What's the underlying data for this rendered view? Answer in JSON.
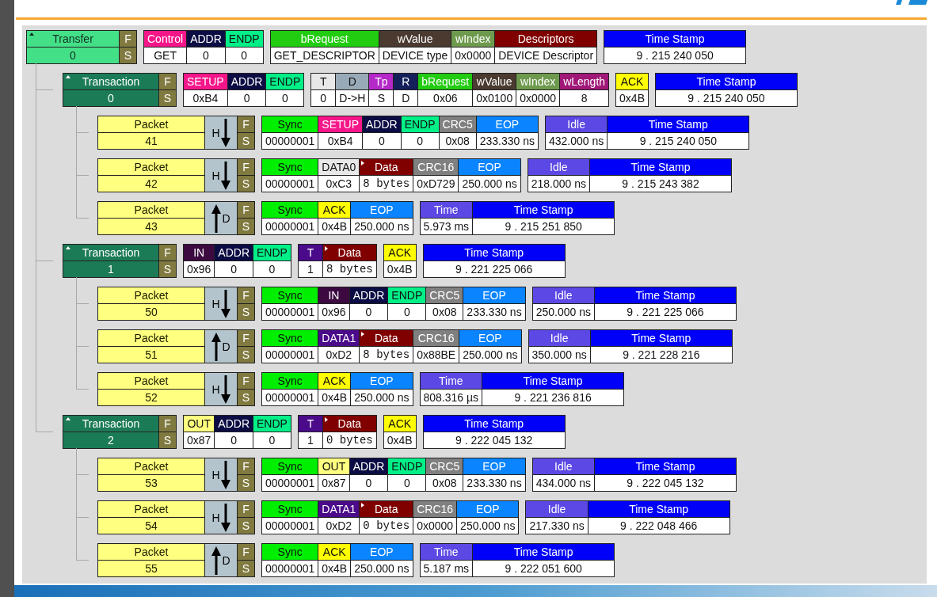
{
  "rows": [
    {
      "kind": "transfer",
      "label": "Transfer",
      "number": "0",
      "expanded": true,
      "f": "F",
      "s": "S",
      "groups": [
        [
          {
            "kind": "field",
            "label": "Control",
            "value": "GET",
            "color": "#f5168a"
          },
          {
            "kind": "field",
            "label": "ADDR",
            "value": "0",
            "color": "#0c0c44"
          },
          {
            "kind": "field",
            "label": "ENDP",
            "value": "0",
            "color": "#00f088"
          }
        ],
        [
          {
            "kind": "field",
            "label": "bRequest",
            "value": "GET_DESCRIPTOR",
            "color": "#22cc11"
          },
          {
            "kind": "field",
            "label": "wValue",
            "value": "DEVICE type",
            "color": "#4a3a30"
          },
          {
            "kind": "field",
            "label": "wIndex",
            "value": "0x0000",
            "color": "#6e9a4e"
          },
          {
            "kind": "field",
            "label": "Descriptors",
            "value": "DEVICE Descriptor",
            "color": "#800000"
          }
        ],
        [
          {
            "kind": "field",
            "label": "Time Stamp",
            "value": "9 . 215 240 050",
            "color": "#0000f8"
          }
        ]
      ],
      "children": [
        {
          "kind": "transaction",
          "label": "Transaction",
          "number": "0",
          "expanded": true,
          "f": "F",
          "s": "S",
          "groups": [
            [
              {
                "kind": "field",
                "label": "SETUP",
                "value": "0xB4",
                "color": "#f5168a"
              },
              {
                "kind": "field",
                "label": "ADDR",
                "value": "0",
                "color": "#0c0c44"
              },
              {
                "kind": "field",
                "label": "ENDP",
                "value": "0",
                "color": "#00f088"
              }
            ],
            [
              {
                "kind": "field",
                "label": "T",
                "value": "0",
                "color": "#e8e8e8"
              },
              {
                "kind": "field",
                "label": "D",
                "value": "D->H",
                "color": "#98aab8"
              },
              {
                "kind": "field",
                "label": "Tp",
                "value": "S",
                "color": "#b428c8"
              },
              {
                "kind": "field",
                "label": "R",
                "value": "D",
                "color": "#14205a"
              },
              {
                "kind": "field",
                "label": "bRequest",
                "value": "0x06",
                "color": "#22cc11"
              },
              {
                "kind": "field",
                "label": "wValue",
                "value": "0x0100",
                "color": "#4a3a30"
              },
              {
                "kind": "field",
                "label": "wIndex",
                "value": "0x0000",
                "color": "#6e9a4e"
              },
              {
                "kind": "field",
                "label": "wLength",
                "value": "8",
                "color": "#a01878"
              }
            ],
            [
              {
                "kind": "field",
                "label": "ACK",
                "value": "0x4B",
                "color": "#ffff00"
              }
            ],
            [
              {
                "kind": "field",
                "label": "Time Stamp",
                "value": "9 . 215 240 050",
                "color": "#0000f8"
              }
            ]
          ],
          "children": [
            {
              "kind": "packet",
              "label": "Packet",
              "number": "41",
              "upward": false,
              "side": "H",
              "f": "F",
              "s": "S",
              "groups": [
                [
                  {
                    "kind": "field",
                    "label": "Sync",
                    "value": "00000001",
                    "color": "#00ee00"
                  },
                  {
                    "kind": "field",
                    "label": "SETUP",
                    "value": "0xB4",
                    "color": "#f5168a"
                  },
                  {
                    "kind": "field",
                    "label": "ADDR",
                    "value": "0",
                    "color": "#0c0c44"
                  },
                  {
                    "kind": "field",
                    "label": "ENDP",
                    "value": "0",
                    "color": "#00f088"
                  },
                  {
                    "kind": "field",
                    "label": "CRC5",
                    "value": "0x08",
                    "color": "#808080"
                  },
                  {
                    "kind": "field",
                    "label": "EOP",
                    "value": "233.330 ns",
                    "color": "#0a84ff"
                  }
                ],
                [
                  {
                    "kind": "field",
                    "label": "Idle",
                    "value": "432.000 ns",
                    "color": "#5c48e4"
                  },
                  {
                    "kind": "field",
                    "label": "Time Stamp",
                    "value": "9 . 215 240 050",
                    "color": "#0000f8"
                  }
                ]
              ]
            },
            {
              "kind": "packet",
              "label": "Packet",
              "number": "42",
              "upward": false,
              "side": "H",
              "f": "F",
              "s": "S",
              "groups": [
                [
                  {
                    "kind": "field",
                    "label": "Sync",
                    "value": "00000001",
                    "color": "#00ee00"
                  },
                  {
                    "kind": "field",
                    "label": "DATA0",
                    "value": "0xC3",
                    "color": "#e8e8e8"
                  },
                  {
                    "kind": "data",
                    "label": "Data",
                    "value": "8 bytes",
                    "color": "#800000"
                  },
                  {
                    "kind": "field",
                    "label": "CRC16",
                    "value": "0xD729",
                    "color": "#808080"
                  },
                  {
                    "kind": "field",
                    "label": "EOP",
                    "value": "250.000 ns",
                    "color": "#0a84ff"
                  }
                ],
                [
                  {
                    "kind": "field",
                    "label": "Idle",
                    "value": "218.000 ns",
                    "color": "#5c48e4"
                  },
                  {
                    "kind": "field",
                    "label": "Time Stamp",
                    "value": "9 . 215 243 382",
                    "color": "#0000f8"
                  }
                ]
              ]
            },
            {
              "kind": "packet",
              "label": "Packet",
              "number": "43",
              "upward": true,
              "side": "D",
              "f": "F",
              "s": "S",
              "groups": [
                [
                  {
                    "kind": "field",
                    "label": "Sync",
                    "value": "00000001",
                    "color": "#00ee00"
                  },
                  {
                    "kind": "field",
                    "label": "ACK",
                    "value": "0x4B",
                    "color": "#ffff00"
                  },
                  {
                    "kind": "field",
                    "label": "EOP",
                    "value": "250.000 ns",
                    "color": "#0a84ff"
                  }
                ],
                [
                  {
                    "kind": "field",
                    "label": "Time",
                    "value": "5.973 ms",
                    "color": "#5c48e4"
                  },
                  {
                    "kind": "field",
                    "label": "Time Stamp",
                    "value": "9 . 215 251 850",
                    "color": "#0000f8"
                  }
                ]
              ]
            }
          ]
        },
        {
          "kind": "transaction",
          "label": "Transaction",
          "number": "1",
          "expanded": true,
          "f": "F",
          "s": "S",
          "groups": [
            [
              {
                "kind": "field",
                "label": "IN",
                "value": "0x96",
                "color": "#3c0a40"
              },
              {
                "kind": "field",
                "label": "ADDR",
                "value": "0",
                "color": "#0c0c44"
              },
              {
                "kind": "field",
                "label": "ENDP",
                "value": "0",
                "color": "#00f088"
              }
            ],
            [
              {
                "kind": "field",
                "label": "T",
                "value": "1",
                "color": "#4a0a8a"
              },
              {
                "kind": "data",
                "label": "Data",
                "value": "8 bytes",
                "color": "#800000"
              }
            ],
            [
              {
                "kind": "field",
                "label": "ACK",
                "value": "0x4B",
                "color": "#ffff00"
              }
            ],
            [
              {
                "kind": "field",
                "label": "Time Stamp",
                "value": "9 . 221 225 066",
                "color": "#0000f8"
              }
            ]
          ],
          "children": [
            {
              "kind": "packet",
              "label": "Packet",
              "number": "50",
              "upward": false,
              "side": "H",
              "f": "F",
              "s": "S",
              "groups": [
                [
                  {
                    "kind": "field",
                    "label": "Sync",
                    "value": "00000001",
                    "color": "#00ee00"
                  },
                  {
                    "kind": "field",
                    "label": "IN",
                    "value": "0x96",
                    "color": "#3c0a40"
                  },
                  {
                    "kind": "field",
                    "label": "ADDR",
                    "value": "0",
                    "color": "#0c0c44"
                  },
                  {
                    "kind": "field",
                    "label": "ENDP",
                    "value": "0",
                    "color": "#00f088"
                  },
                  {
                    "kind": "field",
                    "label": "CRC5",
                    "value": "0x08",
                    "color": "#808080"
                  },
                  {
                    "kind": "field",
                    "label": "EOP",
                    "value": "233.330 ns",
                    "color": "#0a84ff"
                  }
                ],
                [
                  {
                    "kind": "field",
                    "label": "Idle",
                    "value": "250.000 ns",
                    "color": "#5c48e4"
                  },
                  {
                    "kind": "field",
                    "label": "Time Stamp",
                    "value": "9 . 221 225 066",
                    "color": "#0000f8"
                  }
                ]
              ]
            },
            {
              "kind": "packet",
              "label": "Packet",
              "number": "51",
              "upward": true,
              "side": "D",
              "f": "F",
              "s": "S",
              "groups": [
                [
                  {
                    "kind": "field",
                    "label": "Sync",
                    "value": "00000001",
                    "color": "#00ee00"
                  },
                  {
                    "kind": "field",
                    "label": "DATA1",
                    "value": "0xD2",
                    "color": "#4a0a8a"
                  },
                  {
                    "kind": "data",
                    "label": "Data",
                    "value": "8 bytes",
                    "color": "#800000"
                  },
                  {
                    "kind": "field",
                    "label": "CRC16",
                    "value": "0x88BE",
                    "color": "#808080"
                  },
                  {
                    "kind": "field",
                    "label": "EOP",
                    "value": "250.000 ns",
                    "color": "#0a84ff"
                  }
                ],
                [
                  {
                    "kind": "field",
                    "label": "Idle",
                    "value": "350.000 ns",
                    "color": "#5c48e4"
                  },
                  {
                    "kind": "field",
                    "label": "Time Stamp",
                    "value": "9 . 221 228 216",
                    "color": "#0000f8"
                  }
                ]
              ]
            },
            {
              "kind": "packet",
              "label": "Packet",
              "number": "52",
              "upward": false,
              "side": "H",
              "f": "F",
              "s": "S",
              "groups": [
                [
                  {
                    "kind": "field",
                    "label": "Sync",
                    "value": "00000001",
                    "color": "#00ee00"
                  },
                  {
                    "kind": "field",
                    "label": "ACK",
                    "value": "0x4B",
                    "color": "#ffff00"
                  },
                  {
                    "kind": "field",
                    "label": "EOP",
                    "value": "250.000 ns",
                    "color": "#0a84ff"
                  }
                ],
                [
                  {
                    "kind": "field",
                    "label": "Time",
                    "value": "808.316 µs",
                    "color": "#5c48e4"
                  },
                  {
                    "kind": "field",
                    "label": "Time Stamp",
                    "value": "9 . 221 236 816",
                    "color": "#0000f8"
                  }
                ]
              ]
            }
          ]
        },
        {
          "kind": "transaction",
          "label": "Transaction",
          "number": "2",
          "expanded": true,
          "f": "F",
          "s": "S",
          "groups": [
            [
              {
                "kind": "field",
                "label": "OUT",
                "value": "0x87",
                "color": "#ffff80"
              },
              {
                "kind": "field",
                "label": "ADDR",
                "value": "0",
                "color": "#0c0c44"
              },
              {
                "kind": "field",
                "label": "ENDP",
                "value": "0",
                "color": "#00f088"
              }
            ],
            [
              {
                "kind": "field",
                "label": "T",
                "value": "1",
                "color": "#4a0a8a"
              },
              {
                "kind": "data",
                "label": "Data",
                "value": "0 bytes",
                "color": "#800000"
              }
            ],
            [
              {
                "kind": "field",
                "label": "ACK",
                "value": "0x4B",
                "color": "#ffff00"
              }
            ],
            [
              {
                "kind": "field",
                "label": "Time Stamp",
                "value": "9 . 222 045 132",
                "color": "#0000f8"
              }
            ]
          ],
          "children": [
            {
              "kind": "packet",
              "label": "Packet",
              "number": "53",
              "upward": false,
              "side": "H",
              "f": "F",
              "s": "S",
              "groups": [
                [
                  {
                    "kind": "field",
                    "label": "Sync",
                    "value": "00000001",
                    "color": "#00ee00"
                  },
                  {
                    "kind": "field",
                    "label": "OUT",
                    "value": "0x87",
                    "color": "#ffff80"
                  },
                  {
                    "kind": "field",
                    "label": "ADDR",
                    "value": "0",
                    "color": "#0c0c44"
                  },
                  {
                    "kind": "field",
                    "label": "ENDP",
                    "value": "0",
                    "color": "#00f088"
                  },
                  {
                    "kind": "field",
                    "label": "CRC5",
                    "value": "0x08",
                    "color": "#808080"
                  },
                  {
                    "kind": "field",
                    "label": "EOP",
                    "value": "233.330 ns",
                    "color": "#0a84ff"
                  }
                ],
                [
                  {
                    "kind": "field",
                    "label": "Idle",
                    "value": "434.000 ns",
                    "color": "#5c48e4"
                  },
                  {
                    "kind": "field",
                    "label": "Time Stamp",
                    "value": "9 . 222 045 132",
                    "color": "#0000f8"
                  }
                ]
              ]
            },
            {
              "kind": "packet",
              "label": "Packet",
              "number": "54",
              "upward": false,
              "side": "H",
              "f": "F",
              "s": "S",
              "groups": [
                [
                  {
                    "kind": "field",
                    "label": "Sync",
                    "value": "00000001",
                    "color": "#00ee00"
                  },
                  {
                    "kind": "field",
                    "label": "DATA1",
                    "value": "0xD2",
                    "color": "#4a0a8a"
                  },
                  {
                    "kind": "data",
                    "label": "Data",
                    "value": "0 bytes",
                    "color": "#800000"
                  },
                  {
                    "kind": "field",
                    "label": "CRC16",
                    "value": "0x0000",
                    "color": "#808080"
                  },
                  {
                    "kind": "field",
                    "label": "EOP",
                    "value": "250.000 ns",
                    "color": "#0a84ff"
                  }
                ],
                [
                  {
                    "kind": "field",
                    "label": "Idle",
                    "value": "217.330 ns",
                    "color": "#5c48e4"
                  },
                  {
                    "kind": "field",
                    "label": "Time Stamp",
                    "value": "9 . 222 048 466",
                    "color": "#0000f8"
                  }
                ]
              ]
            },
            {
              "kind": "packet",
              "label": "Packet",
              "number": "55",
              "upward": true,
              "side": "D",
              "f": "F",
              "s": "S",
              "groups": [
                [
                  {
                    "kind": "field",
                    "label": "Sync",
                    "value": "00000001",
                    "color": "#00ee00"
                  },
                  {
                    "kind": "field",
                    "label": "ACK",
                    "value": "0x4B",
                    "color": "#ffff00"
                  },
                  {
                    "kind": "field",
                    "label": "EOP",
                    "value": "250.000 ns",
                    "color": "#0a84ff"
                  }
                ],
                [
                  {
                    "kind": "field",
                    "label": "Time",
                    "value": "5.187 ms",
                    "color": "#5c48e4"
                  },
                  {
                    "kind": "field",
                    "label": "Time Stamp",
                    "value": "9 . 222 051 600",
                    "color": "#0000f8"
                  }
                ]
              ]
            }
          ]
        }
      ]
    }
  ]
}
